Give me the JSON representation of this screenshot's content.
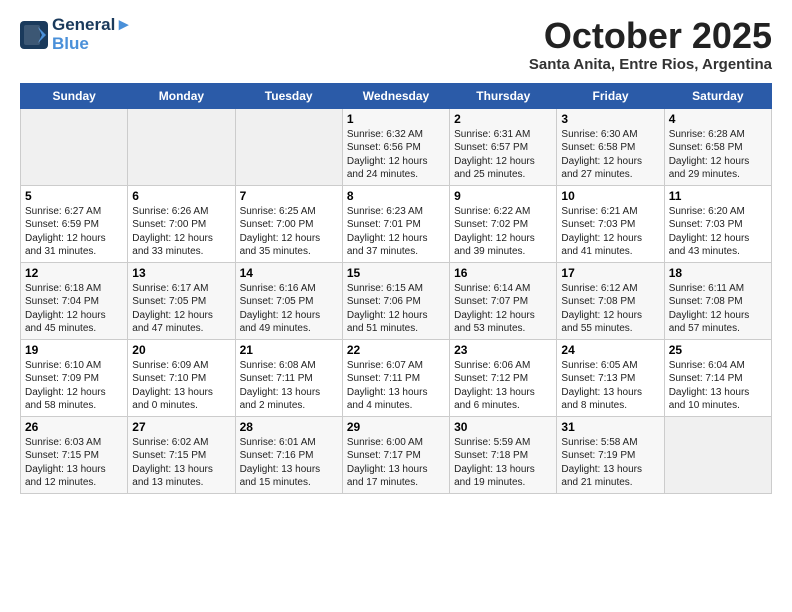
{
  "header": {
    "logo_line1": "General",
    "logo_line2": "Blue",
    "month": "October 2025",
    "location": "Santa Anita, Entre Rios, Argentina"
  },
  "weekdays": [
    "Sunday",
    "Monday",
    "Tuesday",
    "Wednesday",
    "Thursday",
    "Friday",
    "Saturday"
  ],
  "weeks": [
    [
      {
        "day": "",
        "info": ""
      },
      {
        "day": "",
        "info": ""
      },
      {
        "day": "",
        "info": ""
      },
      {
        "day": "1",
        "info": "Sunrise: 6:32 AM\nSunset: 6:56 PM\nDaylight: 12 hours\nand 24 minutes."
      },
      {
        "day": "2",
        "info": "Sunrise: 6:31 AM\nSunset: 6:57 PM\nDaylight: 12 hours\nand 25 minutes."
      },
      {
        "day": "3",
        "info": "Sunrise: 6:30 AM\nSunset: 6:58 PM\nDaylight: 12 hours\nand 27 minutes."
      },
      {
        "day": "4",
        "info": "Sunrise: 6:28 AM\nSunset: 6:58 PM\nDaylight: 12 hours\nand 29 minutes."
      }
    ],
    [
      {
        "day": "5",
        "info": "Sunrise: 6:27 AM\nSunset: 6:59 PM\nDaylight: 12 hours\nand 31 minutes."
      },
      {
        "day": "6",
        "info": "Sunrise: 6:26 AM\nSunset: 7:00 PM\nDaylight: 12 hours\nand 33 minutes."
      },
      {
        "day": "7",
        "info": "Sunrise: 6:25 AM\nSunset: 7:00 PM\nDaylight: 12 hours\nand 35 minutes."
      },
      {
        "day": "8",
        "info": "Sunrise: 6:23 AM\nSunset: 7:01 PM\nDaylight: 12 hours\nand 37 minutes."
      },
      {
        "day": "9",
        "info": "Sunrise: 6:22 AM\nSunset: 7:02 PM\nDaylight: 12 hours\nand 39 minutes."
      },
      {
        "day": "10",
        "info": "Sunrise: 6:21 AM\nSunset: 7:03 PM\nDaylight: 12 hours\nand 41 minutes."
      },
      {
        "day": "11",
        "info": "Sunrise: 6:20 AM\nSunset: 7:03 PM\nDaylight: 12 hours\nand 43 minutes."
      }
    ],
    [
      {
        "day": "12",
        "info": "Sunrise: 6:18 AM\nSunset: 7:04 PM\nDaylight: 12 hours\nand 45 minutes."
      },
      {
        "day": "13",
        "info": "Sunrise: 6:17 AM\nSunset: 7:05 PM\nDaylight: 12 hours\nand 47 minutes."
      },
      {
        "day": "14",
        "info": "Sunrise: 6:16 AM\nSunset: 7:05 PM\nDaylight: 12 hours\nand 49 minutes."
      },
      {
        "day": "15",
        "info": "Sunrise: 6:15 AM\nSunset: 7:06 PM\nDaylight: 12 hours\nand 51 minutes."
      },
      {
        "day": "16",
        "info": "Sunrise: 6:14 AM\nSunset: 7:07 PM\nDaylight: 12 hours\nand 53 minutes."
      },
      {
        "day": "17",
        "info": "Sunrise: 6:12 AM\nSunset: 7:08 PM\nDaylight: 12 hours\nand 55 minutes."
      },
      {
        "day": "18",
        "info": "Sunrise: 6:11 AM\nSunset: 7:08 PM\nDaylight: 12 hours\nand 57 minutes."
      }
    ],
    [
      {
        "day": "19",
        "info": "Sunrise: 6:10 AM\nSunset: 7:09 PM\nDaylight: 12 hours\nand 58 minutes."
      },
      {
        "day": "20",
        "info": "Sunrise: 6:09 AM\nSunset: 7:10 PM\nDaylight: 13 hours\nand 0 minutes."
      },
      {
        "day": "21",
        "info": "Sunrise: 6:08 AM\nSunset: 7:11 PM\nDaylight: 13 hours\nand 2 minutes."
      },
      {
        "day": "22",
        "info": "Sunrise: 6:07 AM\nSunset: 7:11 PM\nDaylight: 13 hours\nand 4 minutes."
      },
      {
        "day": "23",
        "info": "Sunrise: 6:06 AM\nSunset: 7:12 PM\nDaylight: 13 hours\nand 6 minutes."
      },
      {
        "day": "24",
        "info": "Sunrise: 6:05 AM\nSunset: 7:13 PM\nDaylight: 13 hours\nand 8 minutes."
      },
      {
        "day": "25",
        "info": "Sunrise: 6:04 AM\nSunset: 7:14 PM\nDaylight: 13 hours\nand 10 minutes."
      }
    ],
    [
      {
        "day": "26",
        "info": "Sunrise: 6:03 AM\nSunset: 7:15 PM\nDaylight: 13 hours\nand 12 minutes."
      },
      {
        "day": "27",
        "info": "Sunrise: 6:02 AM\nSunset: 7:15 PM\nDaylight: 13 hours\nand 13 minutes."
      },
      {
        "day": "28",
        "info": "Sunrise: 6:01 AM\nSunset: 7:16 PM\nDaylight: 13 hours\nand 15 minutes."
      },
      {
        "day": "29",
        "info": "Sunrise: 6:00 AM\nSunset: 7:17 PM\nDaylight: 13 hours\nand 17 minutes."
      },
      {
        "day": "30",
        "info": "Sunrise: 5:59 AM\nSunset: 7:18 PM\nDaylight: 13 hours\nand 19 minutes."
      },
      {
        "day": "31",
        "info": "Sunrise: 5:58 AM\nSunset: 7:19 PM\nDaylight: 13 hours\nand 21 minutes."
      },
      {
        "day": "",
        "info": ""
      }
    ]
  ]
}
